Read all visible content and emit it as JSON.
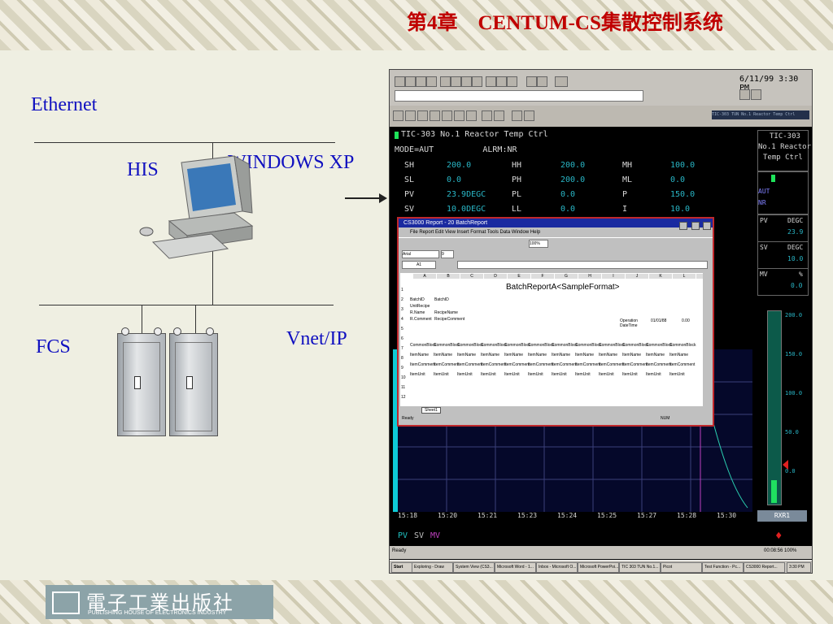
{
  "slide": {
    "title": "第4章　CENTUM-CS集散控制系统",
    "labels": {
      "ethernet": "Ethernet",
      "his": "HIS",
      "windows": "WINDOWS XP",
      "fcs": "FCS",
      "vnet": "Vnet/IP"
    },
    "publisher_logo_text": "電子工業出版社",
    "publisher_logo_subtext": "PUBLISHING HOUSE OF ELECTRONICS INDUSTRY"
  },
  "screen": {
    "clock": "6/11/99 3:30 PM",
    "tag_header": "TIC-303 TUN No.1 Reactor Temp Ctrl",
    "faceplate_title": "TIC-303 No.1 Reactor Temp Ctrl",
    "mode_line": "MODE=AUT          ALRM:NR",
    "params": [
      {
        "l1": "SH",
        "v1": "200.0",
        "l2": "HH",
        "v2": "200.0",
        "l3": "MH",
        "v3": "100.0"
      },
      {
        "l1": "SL",
        "v1": "0.0",
        "l2": "PH",
        "v2": "200.0",
        "l3": "ML",
        "v3": "0.0"
      },
      {
        "l1": "PV",
        "v1": "23.9DEGC",
        "l2": "PL",
        "v2": "0.0",
        "l3": "P",
        "v3": "150.0"
      },
      {
        "l1": "SV",
        "v1": "10.0DEGC",
        "l2": "LL",
        "v2": "0.0",
        "l3": "I",
        "v3": "10.0"
      }
    ],
    "side": {
      "tag": "TIC-303",
      "desc1": "No.1 Reactor",
      "desc2": "Temp Ctrl",
      "mode": "AUT",
      "alarm": "NR",
      "pv_label": "PV",
      "pv_unit": "DEGC",
      "pv_value": "23.9",
      "sv_label": "SV",
      "sv_unit": "DEGC",
      "sv_value": "10.0",
      "mv_label": "MV",
      "mv_unit": "%",
      "mv_value": "0.0",
      "scale": [
        "200.0",
        "150.0",
        "100.0",
        "50.0",
        "0.0"
      ],
      "station": "RXR1"
    },
    "trend_times": [
      "15:18",
      "15:20",
      "15:21",
      "15:23",
      "15:24",
      "15:25",
      "15:27",
      "15:28",
      "15:30"
    ],
    "trend_legend": [
      "PV",
      "SV",
      "MV"
    ],
    "status_left": "Ready",
    "status_right": "00:08:56  100%",
    "report": {
      "title": "CS3000 Report - 20 BatchReport",
      "menu": "File  Report  Edit  View  Insert  Format  Tools  Data  Window  Help",
      "font": "Arial",
      "size": "9",
      "zoom": "100%",
      "cell_ref": "A1",
      "columns": [
        "A",
        "B",
        "C",
        "D",
        "E",
        "F",
        "G",
        "H",
        "I",
        "J",
        "K",
        "L",
        "M"
      ],
      "sheet_title": "BatchReportA<SampleFormat>",
      "rows": [
        [
          "BatchID",
          "BatchID"
        ],
        [
          "UnitRecipe",
          ""
        ],
        [
          "R.Name",
          "RecipeName"
        ],
        [
          "R.Comment",
          "RecipeComment"
        ]
      ],
      "op_label": "Operation DateTime",
      "op_date": "01/01/88",
      "op_value": "0.00",
      "row_nums": [
        "1",
        "2",
        "3",
        "4",
        "5",
        "6",
        "7",
        "8",
        "9",
        "10",
        "11",
        "12"
      ],
      "common": "CommonBlock",
      "item_name": "ItemName",
      "item_comment": "ItemComment",
      "item_unit": "ItemUnit",
      "sheet_tab": "Sheet1",
      "status": "Ready",
      "num": "NUM"
    },
    "taskbar": {
      "start": "Start",
      "items": [
        "Exploring - Draw",
        "System View (CS3...",
        "Microsoft Word - 1...",
        "Inbox - Microsoft O...",
        "Microsoft PowerPoi...",
        "TIC 303 TUN No.1...",
        "Picot",
        "Test Function - Pc...",
        "CS3000 Report..."
      ],
      "time": "3:30 PM"
    }
  }
}
